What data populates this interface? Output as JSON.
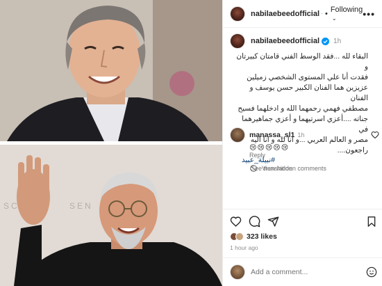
{
  "post": {
    "username": "nabilaebeedofficial",
    "follow_label": "Following",
    "more_label": "•••",
    "time": "1h",
    "caption_lines": [
      "البقاء لله ...فقد الوسط الفني قامتان كبيرتان و",
      "فقدت أنا علي المستوى الشخصي زميلين",
      "عزيزين هما الفنان الكبير حسن يوسف و الفنان",
      "مصطفي فهمي رحمهما الله و ادخلهما فسيح",
      "جناته ....أعزي اسرتيهما و أعزي جماهيرهما في",
      "مصر و العالم العربي ...و انا لله و انا اليه",
      "راجعون...."
    ],
    "hashtag": "#نبيلة_عبيد",
    "see_translation": "See translation",
    "likes": "323 likes",
    "time_ago": "1 hour ago",
    "add_comment_placeholder": "Add a comment..."
  },
  "comment": {
    "username": "manassa_sl1",
    "time": "1h",
    "text": "😢😢😢😢😢",
    "reply_label": "Reply",
    "view_hidden_label": "View hidden comments"
  },
  "colors": {
    "verified": "#0095f6",
    "hashtag": "#00376b",
    "muted": "#8e8e8e"
  },
  "icons": [
    "verified-icon",
    "more-icon",
    "heart-icon",
    "comment-icon",
    "share-icon",
    "save-icon",
    "emoji-icon",
    "hidden-icon"
  ]
}
